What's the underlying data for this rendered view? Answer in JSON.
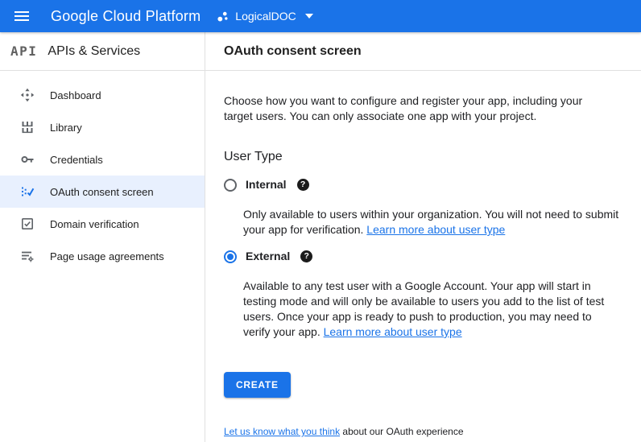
{
  "topbar": {
    "product": "Google Cloud Platform",
    "project": "LogicalDOC"
  },
  "sidebar": {
    "logo": "API",
    "section": "APIs & Services",
    "items": [
      {
        "label": "Dashboard",
        "icon": "dashboard-icon",
        "active": false
      },
      {
        "label": "Library",
        "icon": "library-icon",
        "active": false
      },
      {
        "label": "Credentials",
        "icon": "key-icon",
        "active": false
      },
      {
        "label": "OAuth consent screen",
        "icon": "fact-check-icon",
        "active": true
      },
      {
        "label": "Domain verification",
        "icon": "domain-verification-icon",
        "active": false
      },
      {
        "label": "Page usage agreements",
        "icon": "page-usage-icon",
        "active": false
      }
    ]
  },
  "main": {
    "title": "OAuth consent screen",
    "intro": "Choose how you want to configure and register your app, including your target users. You can only associate one app with your project.",
    "user_type": {
      "heading": "User Type",
      "help_glyph": "?",
      "options": [
        {
          "label": "Internal",
          "selected": false,
          "description": "Only available to users within your organization. You will not need to submit your app for verification. ",
          "link": "Learn more about user type"
        },
        {
          "label": "External",
          "selected": true,
          "description": "Available to any test user with a Google Account. Your app will start in testing mode and will only be available to users you add to the list of test users. Once your app is ready to push to production, you may need to verify your app. ",
          "link": "Learn more about user type"
        }
      ]
    },
    "create_button": "CREATE",
    "footer": {
      "link": "Let us know what you think",
      "text": " about our OAuth experience"
    }
  },
  "colors": {
    "topbar": "#1a73e8",
    "accent": "#1a73e8",
    "link": "#1a73e8",
    "active_item_bg": "#e8f0fe",
    "icon_gray": "#5f6368"
  }
}
